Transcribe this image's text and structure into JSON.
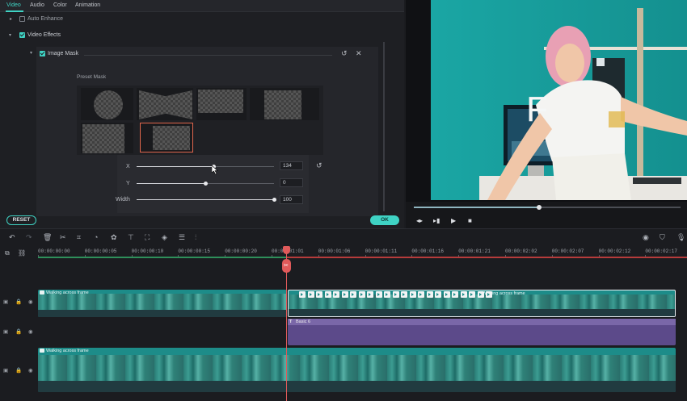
{
  "editor": {
    "tabs": [
      "Video",
      "Audio",
      "Color",
      "Animation"
    ],
    "auto_enhance": "Auto Enhance",
    "video_effects": "Video Effects",
    "image_mask": "Image Mask",
    "preset_mask": "Preset Mask",
    "sliders": [
      {
        "label": "X",
        "value": "134",
        "level": 0.56
      },
      {
        "label": "Y",
        "value": "0",
        "level": 0.5
      },
      {
        "label": "Width",
        "value": "100",
        "level": 1.0
      }
    ],
    "reset_label": "RESET",
    "ok_label": "OK"
  },
  "preview": {
    "overlay_text": "F",
    "progress": 0.47
  },
  "timeline": {
    "timecodes": [
      "00:00:00:00",
      "00:00:00:05",
      "00:00:00:10",
      "00:00:00:15",
      "00:00:00:20",
      "00:00:01:01",
      "00:00:01:06",
      "00:00:01:11",
      "00:00:01:16",
      "00:00:01:21",
      "00:00:02:02",
      "00:00:02:07",
      "00:00:02:12",
      "00:00:02:17"
    ],
    "clips": {
      "track1_left": "Walking across frame",
      "track1_right": "Walking across frame",
      "title": "Basic 6",
      "track3": "Walking across frame"
    }
  },
  "colors": {
    "accent": "#3fd3c4",
    "playhead": "#e05a5a",
    "clip_video": "#1d8c89",
    "clip_title": "#5c4a8a"
  }
}
